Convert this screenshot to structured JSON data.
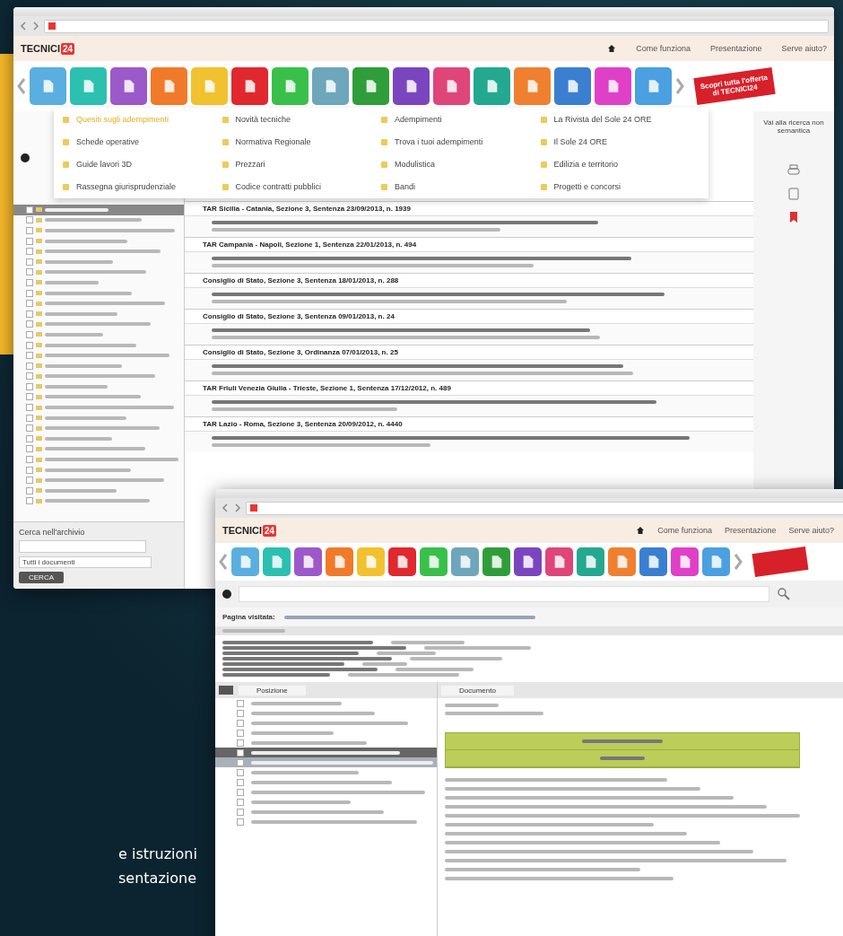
{
  "caption_lines": [
    "e istruzioni",
    "sentazione"
  ],
  "window_main": {
    "logo": {
      "text": "TECNICI",
      "badge": "24"
    },
    "header_links": [
      "Come funziona",
      "Presentazione",
      "Serve aiuto?"
    ],
    "category_tiles": [
      {
        "color": "#5aaee0"
      },
      {
        "color": "#2cc0b0"
      },
      {
        "color": "#9b59c9"
      },
      {
        "color": "#f07a2a"
      },
      {
        "color": "#f2c12e"
      },
      {
        "color": "#e0282e"
      },
      {
        "color": "#39c04a"
      },
      {
        "color": "#6ea6bb"
      },
      {
        "color": "#2f9e3a"
      },
      {
        "color": "#7b45c0"
      },
      {
        "color": "#e0457a"
      },
      {
        "color": "#25a890"
      },
      {
        "color": "#f08030"
      },
      {
        "color": "#3a7fd0"
      },
      {
        "color": "#e040c8"
      },
      {
        "color": "#4aa0e0"
      }
    ],
    "promo_ribbon": "Scopri tutta l'offerta di TECNICI24",
    "side_link": "Vai alla ricerca non semantica",
    "dropdown_columns": [
      [
        {
          "label": "Quesiti sugli adempimenti",
          "selected": true
        },
        {
          "label": "Schede operative",
          "selected": false
        },
        {
          "label": "Guide lavori 3D",
          "selected": false
        },
        {
          "label": "Rassegna giurisprudenziale",
          "selected": false
        }
      ],
      [
        {
          "label": "Novità tecniche",
          "selected": false
        },
        {
          "label": "Normativa Regionale",
          "selected": false
        },
        {
          "label": "Prezzari",
          "selected": false
        },
        {
          "label": "Codice contratti pubblici",
          "selected": false
        }
      ],
      [
        {
          "label": "Adempimenti",
          "selected": false
        },
        {
          "label": "Trova i tuoi adempimenti",
          "selected": false
        },
        {
          "label": "Modulistica",
          "selected": false
        },
        {
          "label": "Bandi",
          "selected": false
        }
      ],
      [
        {
          "label": "La Rivista del Sole 24 ORE",
          "selected": false
        },
        {
          "label": "Il Sole 24 ORE",
          "selected": false
        },
        {
          "label": "Edilizia e territorio",
          "selected": false
        },
        {
          "label": "Progetti e concorsi",
          "selected": false
        }
      ]
    ],
    "tree_items": [
      {
        "selected": true
      },
      {
        "selected": false
      },
      {
        "selected": false
      },
      {
        "selected": false
      },
      {
        "selected": false
      },
      {
        "selected": false
      },
      {
        "selected": false
      },
      {
        "selected": false
      },
      {
        "selected": false
      },
      {
        "selected": false
      },
      {
        "selected": false
      },
      {
        "selected": false
      },
      {
        "selected": false
      },
      {
        "selected": false
      },
      {
        "selected": false
      },
      {
        "selected": false
      },
      {
        "selected": false
      },
      {
        "selected": false
      },
      {
        "selected": false
      },
      {
        "selected": false
      },
      {
        "selected": false
      },
      {
        "selected": false
      },
      {
        "selected": false
      },
      {
        "selected": false
      },
      {
        "selected": false
      },
      {
        "selected": false
      },
      {
        "selected": false
      },
      {
        "selected": false
      },
      {
        "selected": false
      }
    ],
    "archive": {
      "title": "Cerca nell'archivio",
      "select_value": "Tutti i documenti",
      "button": "CERCA"
    },
    "cases": [
      {
        "title": "TAR Sicilia - Catania, Sezione 3, Sentenza 23/09/2013, n. 1939"
      },
      {
        "title": "TAR Campania - Napoli, Sezione 1, Sentenza 22/01/2013, n. 494"
      },
      {
        "title": "Consiglio di Stato, Sezione 3, Sentenza 18/01/2013, n. 288"
      },
      {
        "title": "Consiglio di Stato, Sezione 3, Sentenza 09/01/2013, n. 24"
      },
      {
        "title": "Consiglio di Stato, Sezione 3, Ordinanza 07/01/2013, n. 25"
      },
      {
        "title": "TAR Friuli Venezia Giulia - Trieste, Sezione 1, Sentenza 17/12/2012, n. 489"
      },
      {
        "title": "TAR Lazio - Roma, Sezione 3, Sentenza 20/09/2012, n. 4440"
      }
    ]
  },
  "window_second": {
    "logo": {
      "text": "TECNICI",
      "badge": "24"
    },
    "header_links": [
      "Come funziona",
      "Presentazione",
      "Serve aiuto?"
    ],
    "category_tiles": [
      {
        "color": "#5aaee0"
      },
      {
        "color": "#2cc0b0"
      },
      {
        "color": "#9b59c9"
      },
      {
        "color": "#f07a2a"
      },
      {
        "color": "#f2c12e"
      },
      {
        "color": "#e0282e"
      },
      {
        "color": "#39c04a"
      },
      {
        "color": "#6ea6bb"
      },
      {
        "color": "#2f9e3a"
      },
      {
        "color": "#7b45c0"
      },
      {
        "color": "#e0457a"
      },
      {
        "color": "#25a890"
      },
      {
        "color": "#f08030"
      },
      {
        "color": "#3a7fd0"
      },
      {
        "color": "#e040c8"
      },
      {
        "color": "#4aa0e0"
      }
    ],
    "breadcrumb_label": "Pagina visitata:",
    "left_tab": "Posizione",
    "right_tab": "Documento",
    "position_items": [
      {
        "kind": "row",
        "selected": false
      },
      {
        "kind": "row",
        "selected": false
      },
      {
        "kind": "row",
        "selected": false
      },
      {
        "kind": "row",
        "selected": false
      },
      {
        "kind": "row",
        "selected": false
      },
      {
        "kind": "row",
        "selected": true
      },
      {
        "kind": "group",
        "selected": false
      },
      {
        "kind": "row",
        "selected": false
      },
      {
        "kind": "row",
        "selected": false
      },
      {
        "kind": "row",
        "selected": false
      },
      {
        "kind": "row",
        "selected": false
      },
      {
        "kind": "row",
        "selected": false
      },
      {
        "kind": "row",
        "selected": false
      }
    ]
  }
}
